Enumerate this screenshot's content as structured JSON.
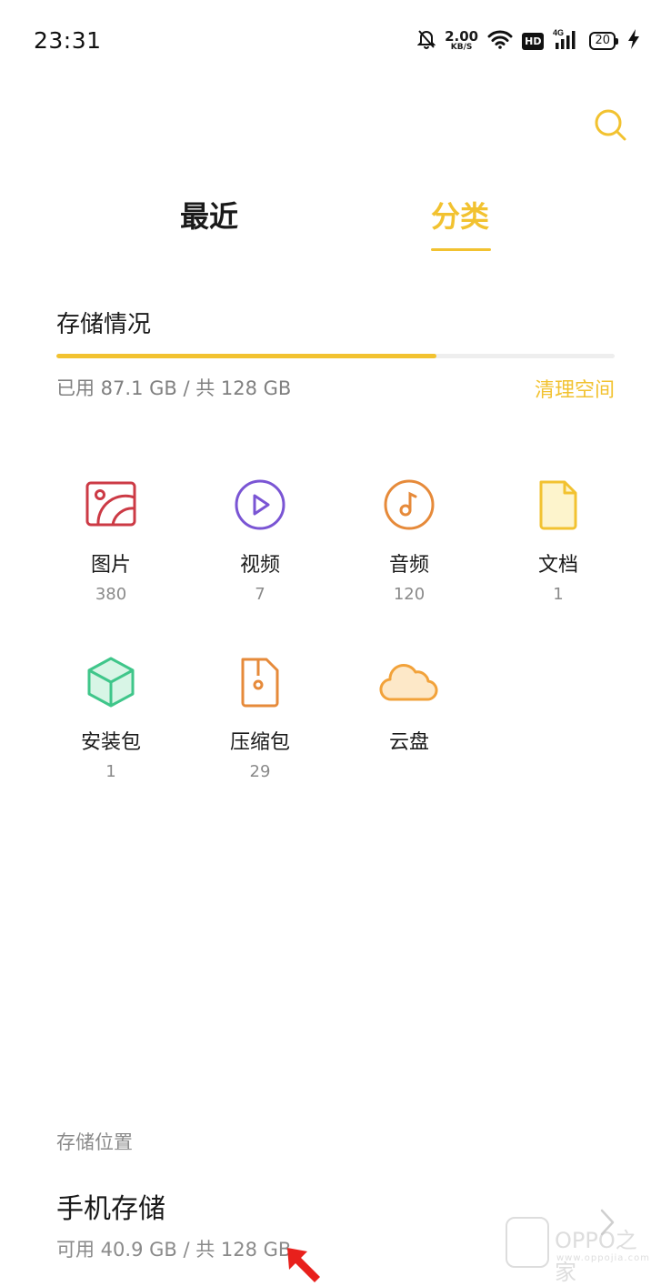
{
  "status_bar": {
    "time": "23:31",
    "net_speed_value": "2.00",
    "net_speed_unit": "KB/S",
    "hd_label": "HD",
    "network_type": "4G",
    "battery_level": "20",
    "icons": [
      "bell-off-icon",
      "wifi-icon",
      "signal-icon",
      "battery-icon",
      "charging-bolt-icon"
    ]
  },
  "header": {
    "search_icon": "search-icon"
  },
  "tabs": [
    {
      "label": "最近",
      "active": false
    },
    {
      "label": "分类",
      "active": true
    }
  ],
  "storage": {
    "title": "存储情况",
    "used_text": "已用 87.1 GB / 共 128 GB",
    "used_fraction": 0.68,
    "clean_label": "清理空间"
  },
  "categories": [
    {
      "label": "图片",
      "count": "380",
      "icon": "image-icon",
      "color": "#cc3a45"
    },
    {
      "label": "视频",
      "count": "7",
      "icon": "video-icon",
      "color": "#7a55d4"
    },
    {
      "label": "音频",
      "count": "120",
      "icon": "audio-icon",
      "color": "#e68a3a"
    },
    {
      "label": "文档",
      "count": "1",
      "icon": "document-icon",
      "color": "#f2c230"
    },
    {
      "label": "安装包",
      "count": "1",
      "icon": "package-icon",
      "color": "#3fc68a"
    },
    {
      "label": "压缩包",
      "count": "29",
      "icon": "archive-icon",
      "color": "#e68a3a"
    },
    {
      "label": "云盘",
      "count": "",
      "icon": "cloud-icon",
      "color": "#f2a23a"
    }
  ],
  "locations": {
    "header": "存储位置",
    "items": [
      {
        "name": "手机存储",
        "available": "可用 40.9 GB / 共 128 GB",
        "icon": "chevron-right-icon"
      }
    ]
  },
  "watermark": {
    "name": "OPPO之家",
    "url": "www.oppojia.com"
  },
  "colors": {
    "accent": "#f2c230",
    "text": "#1a1a1a",
    "secondary": "#8a8a8a",
    "annotation_arrow": "#e8201c"
  }
}
